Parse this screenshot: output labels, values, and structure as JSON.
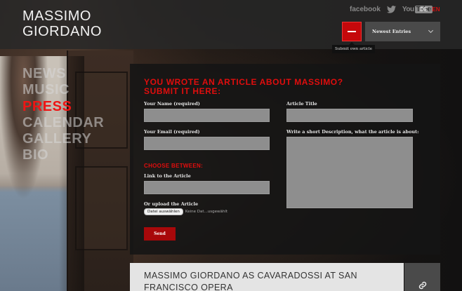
{
  "logo": {
    "line1": "MASSIMO",
    "line2": "GIORDANO"
  },
  "social": {
    "facebook": "facebook",
    "twitter_icon": "twitter-bird-icon",
    "youtube_you": "You",
    "youtube_tube": "Tube"
  },
  "lang": {
    "de": "DE",
    "sep": "|",
    "en": "EN"
  },
  "header": {
    "submit_tooltip": "Submit own article",
    "dropdown_selected": "Newest Entries"
  },
  "nav": {
    "items": [
      "NEWS",
      "MUSIC",
      "PRESS",
      "CALENDAR",
      "GALLERY",
      "BIO"
    ],
    "active": "PRESS"
  },
  "form": {
    "title_line1": "YOU WROTE AN ARTICLE ABOUT MASSIMO?",
    "title_line2": "SUBMIT IT HERE:",
    "name_label": "Your Name (required)",
    "email_label": "Your Email (required)",
    "article_title_label": "Article Title",
    "description_label": "Write a short Description, what the article is about:",
    "choose_between": "CHOOSE BETWEEN:",
    "link_label": "Link to the Article",
    "upload_label": "Or upload the Article",
    "file_button": "Datei auswählen",
    "file_status": "Keine Dat...usgewählt",
    "send": "Send"
  },
  "article": {
    "title": "MASSIMO GIORDANO AS CAVARADOSSI AT SAN FRANCISCO OPERA",
    "icon": "link-icon"
  },
  "colors": {
    "accent": "#e00d0d",
    "field": "#8e8e8e",
    "panel": "#141414"
  }
}
